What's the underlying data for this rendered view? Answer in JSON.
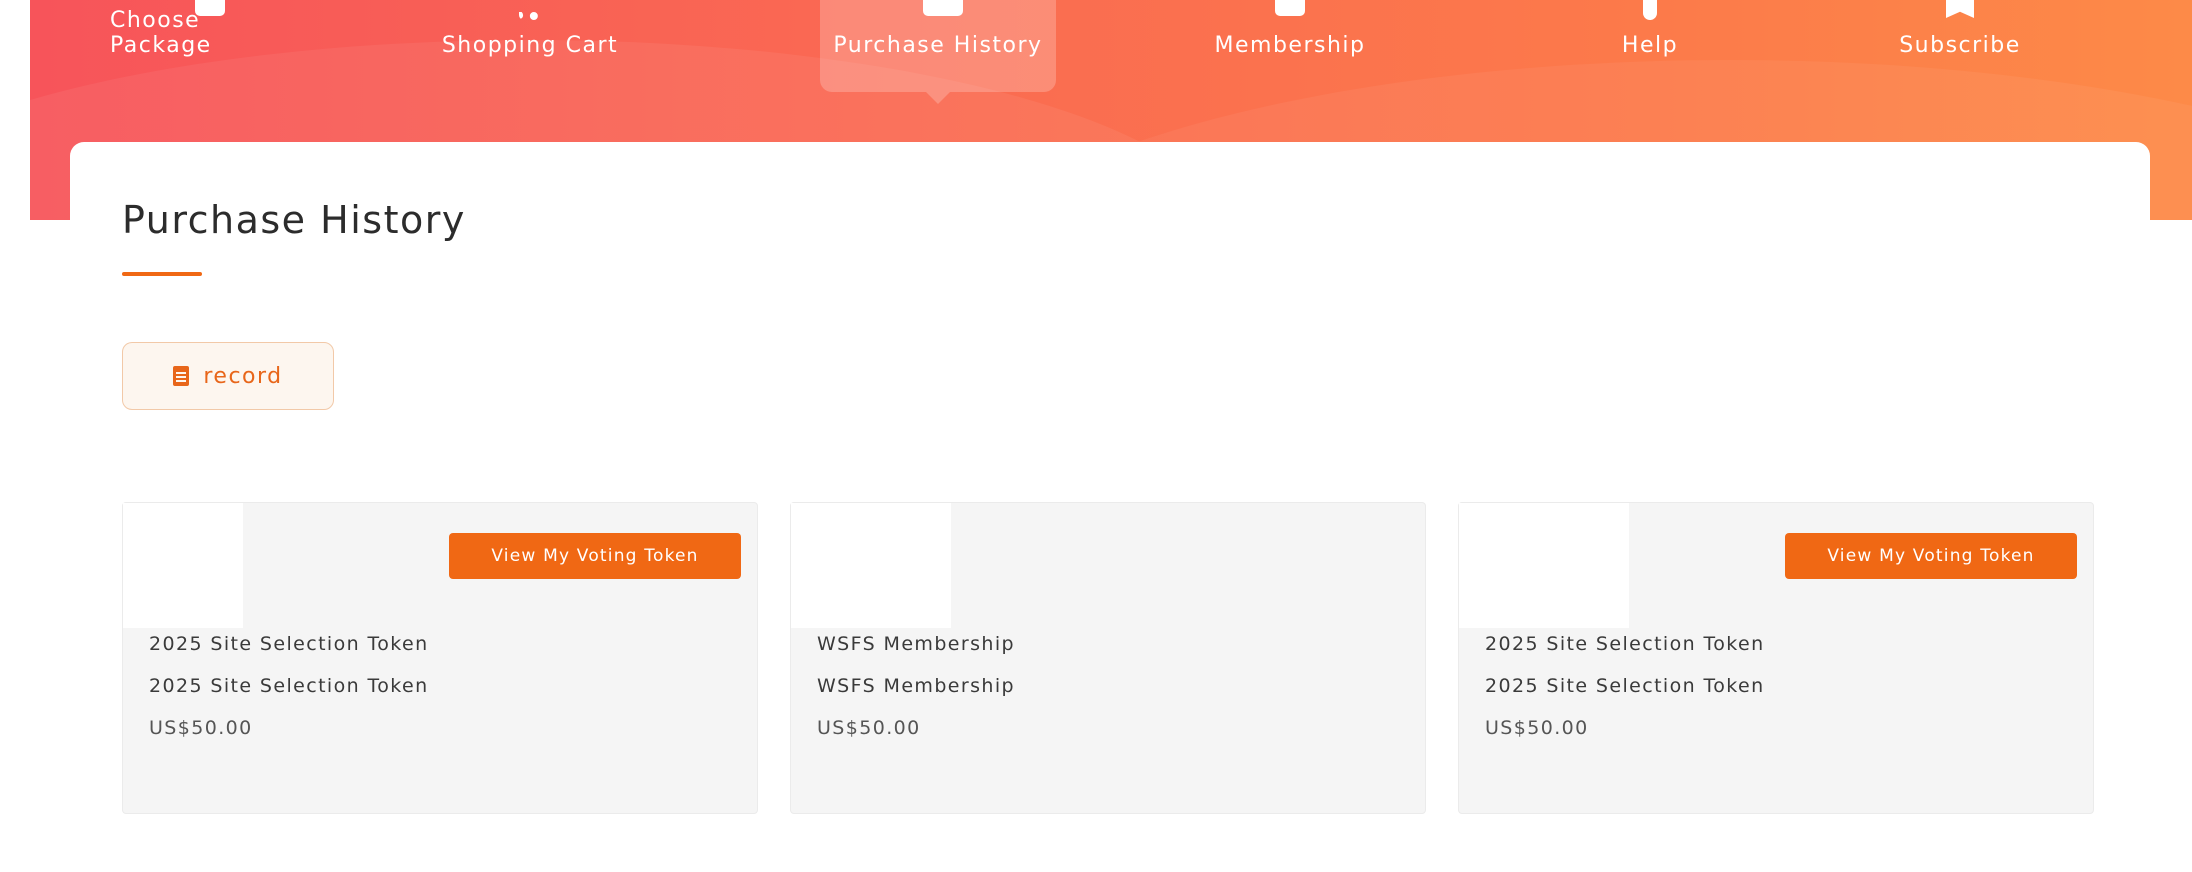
{
  "nav": {
    "items": [
      {
        "label": "Choose Package"
      },
      {
        "label": "Shopping Cart"
      },
      {
        "label": "Purchase History"
      },
      {
        "label": "Membership"
      },
      {
        "label": "Help"
      },
      {
        "label": "Subscribe"
      }
    ],
    "active_index": 2
  },
  "main": {
    "title": "Purchase History",
    "record_button": "record"
  },
  "purchases": [
    {
      "line1": "2025 Site Selection Token",
      "line2": "2025 Site Selection Token",
      "price": "US$50.00",
      "action_label": "View My Voting Token"
    },
    {
      "line1": "WSFS Membership",
      "line2": "WSFS Membership",
      "price": "US$50.00"
    },
    {
      "line1": "2025 Site Selection Token",
      "line2": "2025 Site Selection Token",
      "price": "US$50.00",
      "action_label": "View My Voting Token"
    }
  ],
  "colors": {
    "accent": "#f06814",
    "hero_start": "#f7545a",
    "hero_end": "#fd8a48"
  }
}
